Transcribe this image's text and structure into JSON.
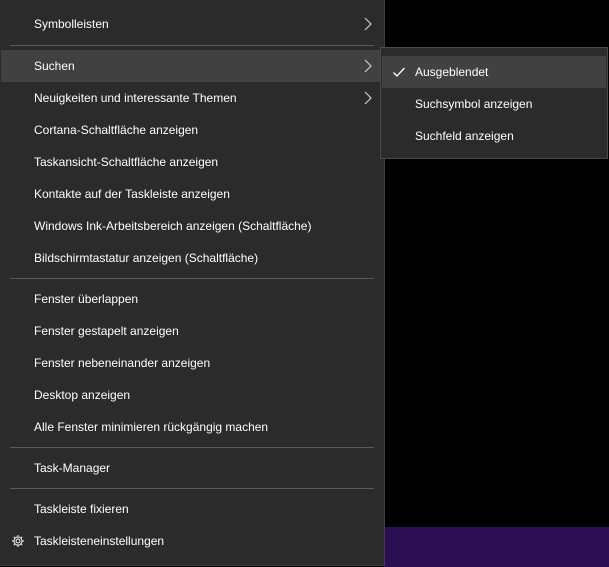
{
  "colors": {
    "menu_bg": "#2b2b2b",
    "hover_bg": "#414141",
    "separator": "#5a5a5a",
    "desktop_bg": "#000000",
    "taskbar_accent": "#2b0f52",
    "text": "#ffffff"
  },
  "context_menu": {
    "items": [
      {
        "label": "Symbolleisten",
        "submenu": true
      },
      {
        "label": "Suchen",
        "submenu": true,
        "highlighted": true
      },
      {
        "label": "Neuigkeiten und interessante Themen",
        "submenu": true
      },
      {
        "label": "Cortana-Schaltfläche anzeigen"
      },
      {
        "label": "Taskansicht-Schaltfläche anzeigen"
      },
      {
        "label": "Kontakte auf der Taskleiste anzeigen"
      },
      {
        "label": "Windows Ink-Arbeitsbereich anzeigen (Schaltfläche)"
      },
      {
        "label": "Bildschirmtastatur anzeigen (Schaltfläche)"
      },
      {
        "label": "Fenster überlappen"
      },
      {
        "label": "Fenster gestapelt anzeigen"
      },
      {
        "label": "Fenster nebeneinander anzeigen"
      },
      {
        "label": "Desktop anzeigen"
      },
      {
        "label": "Alle Fenster minimieren rückgängig machen"
      },
      {
        "label": "Task-Manager"
      },
      {
        "label": "Taskleiste fixieren"
      },
      {
        "label": "Taskleisteneinstellungen",
        "icon": "gear-icon"
      }
    ]
  },
  "search_submenu": {
    "items": [
      {
        "label": "Ausgeblendet",
        "checked": true,
        "icon": "checkmark-icon"
      },
      {
        "label": "Suchsymbol anzeigen"
      },
      {
        "label": "Suchfeld anzeigen"
      }
    ]
  }
}
